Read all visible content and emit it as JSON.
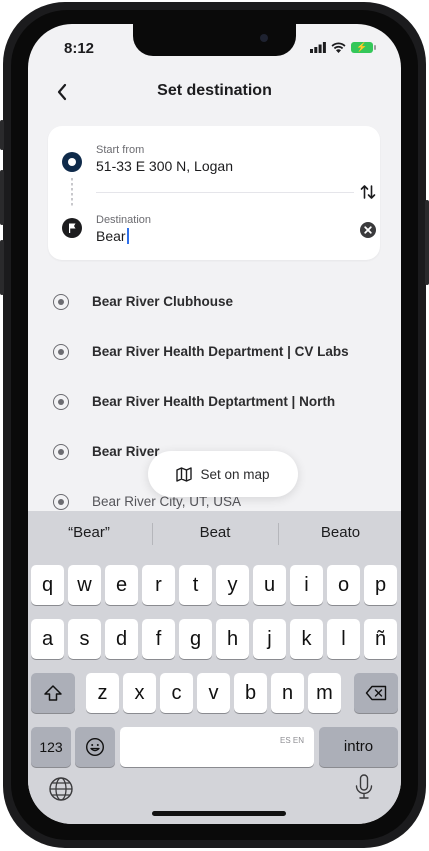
{
  "status_bar": {
    "time": "8:12"
  },
  "nav": {
    "title": "Set destination",
    "back_icon": "chevron-left-icon"
  },
  "route": {
    "start_label": "Start from",
    "start_value": "51-33 E 300 N, Logan",
    "destination_label": "Destination",
    "destination_value": "Bear"
  },
  "results": [
    {
      "text": "Bear River Clubhouse",
      "sub": ""
    },
    {
      "text": "Bear River Health Department | CV Labs",
      "sub": ""
    },
    {
      "text": "Bear River Health Deptartment | North",
      "sub": ""
    },
    {
      "text": "Bear River",
      "sub": ""
    },
    {
      "text": "",
      "sub": "Bear River City, UT, USA"
    }
  ],
  "set_on_map": {
    "label": "Set on map",
    "icon": "map-icon"
  },
  "keyboard": {
    "suggestions": [
      "“Bear”",
      "Beat",
      "Beato"
    ],
    "row1": [
      "q",
      "w",
      "e",
      "r",
      "t",
      "y",
      "u",
      "i",
      "o",
      "p"
    ],
    "row2": [
      "a",
      "s",
      "d",
      "f",
      "g",
      "h",
      "j",
      "k",
      "l",
      "ñ"
    ],
    "row3": [
      "z",
      "x",
      "c",
      "v",
      "b",
      "n",
      "m"
    ],
    "numbers_key": "123",
    "space_lang": "ES EN",
    "return_key": "intro"
  },
  "colors": {
    "accent_blue": "#2f6fe8",
    "start_dot": "#0f2a4a",
    "battery_green": "#34c759"
  }
}
